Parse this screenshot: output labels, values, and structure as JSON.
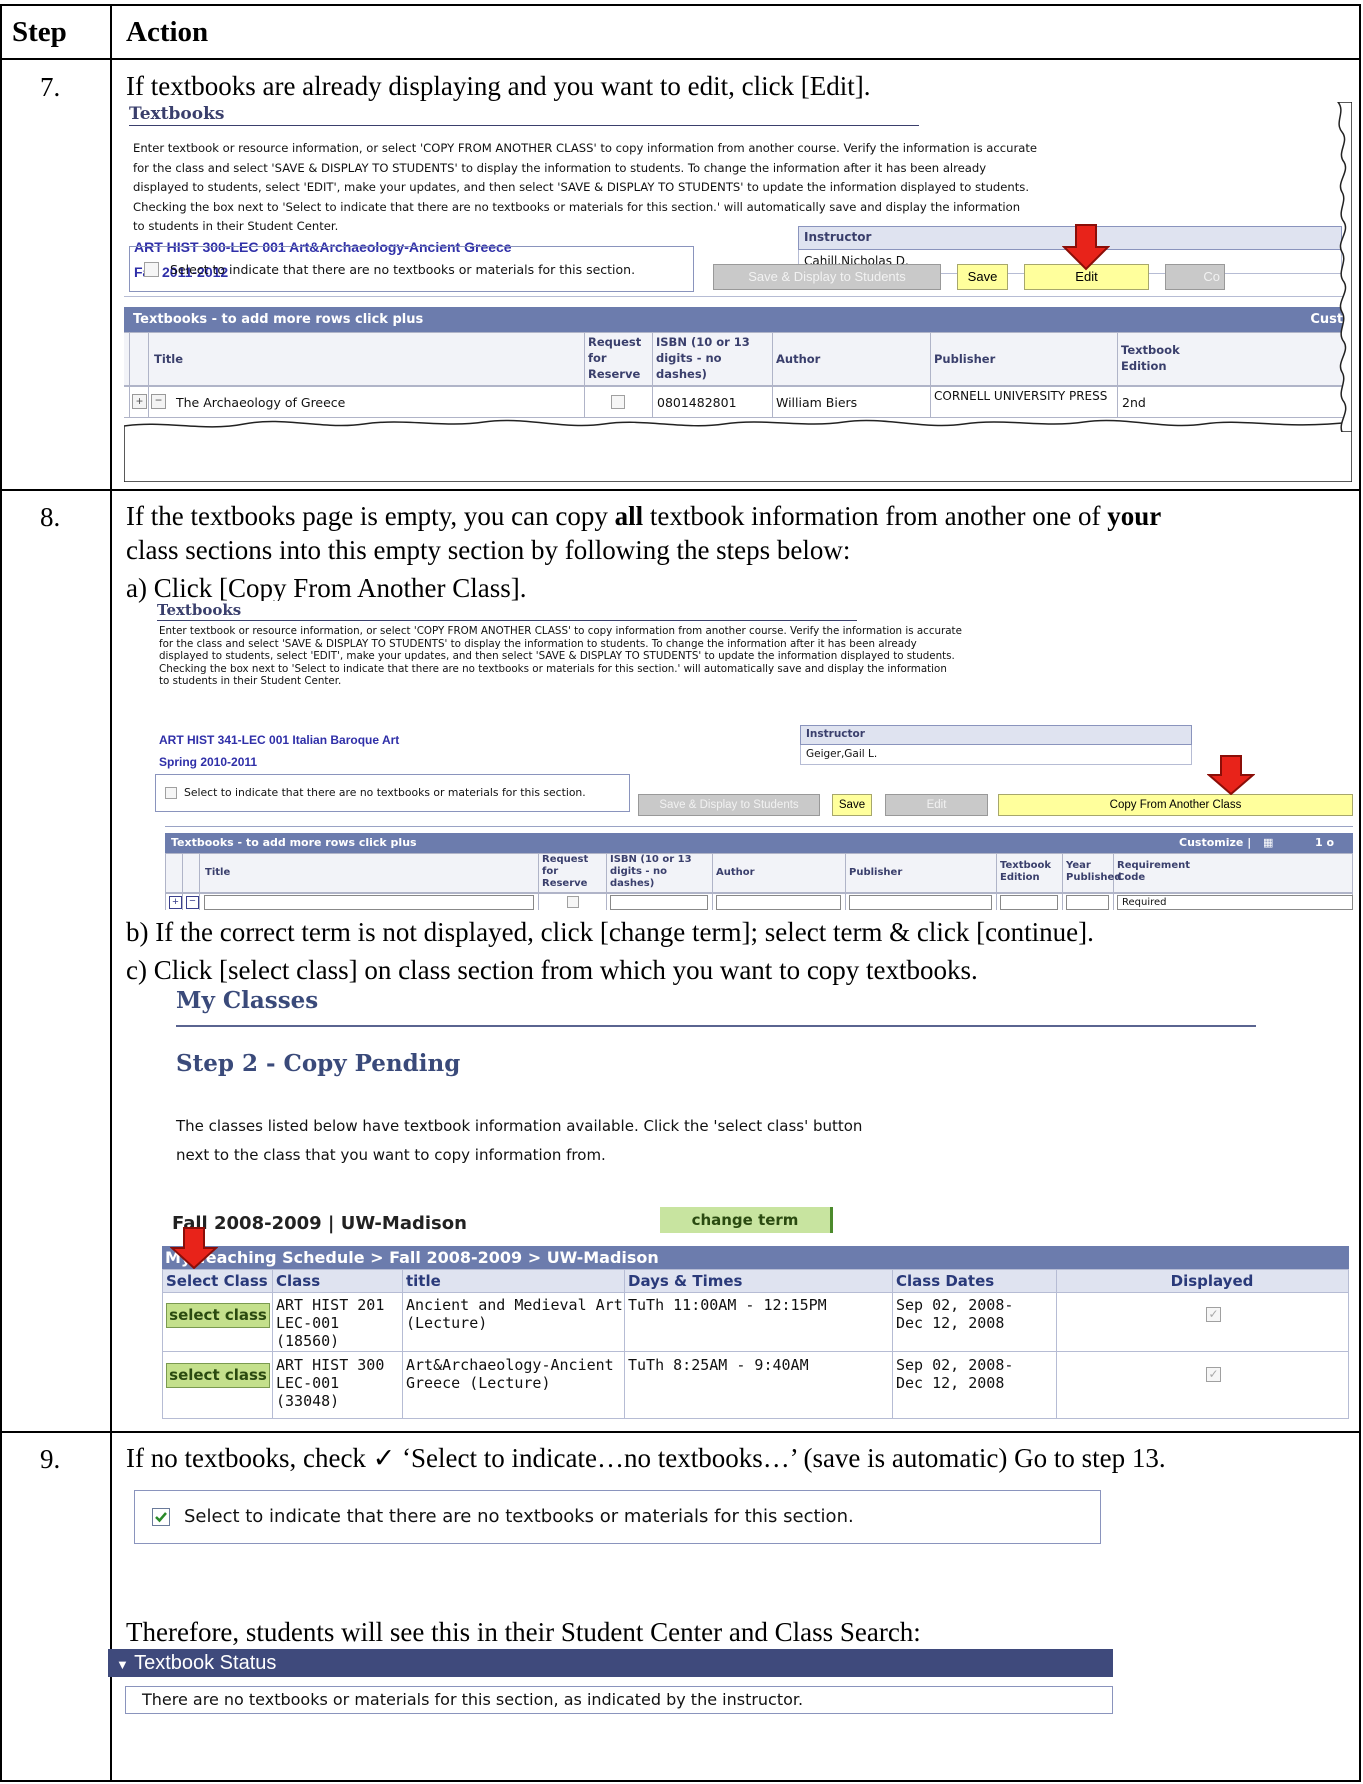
{
  "table": {
    "header_step": "Step",
    "header_action": "Action"
  },
  "step7": {
    "number": "7.",
    "text": "If textbooks are already displaying and you want to edit, click [Edit].",
    "shot": {
      "title": "Textbooks",
      "intro": [
        "Enter textbook or resource information, or select 'COPY FROM ANOTHER CLASS' to copy information from another course. Verify the information is accurate",
        "for the class and select 'SAVE & DISPLAY TO STUDENTS' to display the information to students. To change the information after it has been already",
        "displayed to students, select 'EDIT', make your updates, and then select 'SAVE & DISPLAY TO STUDENTS' to update the information displayed to students.",
        "Checking the box next to 'Select to indicate that there are no textbooks or materials for this section.' will automatically save and display the information",
        "to students in their Student Center."
      ],
      "course": "ART HIST  300-LEC 001   Art&Archaeology-Ancient Greece",
      "term": "Fall 2011-2012",
      "instructor_label": "Instructor",
      "instructor_name": "Cahill,Nicholas D.",
      "no_textbooks_label": "Select to indicate that there are no textbooks or materials for this section.",
      "btn_save_display": "Save & Display to Students",
      "btn_save": "Save",
      "btn_edit": "Edit",
      "btn_copy_partial": "Co",
      "grid_title": "Textbooks - to add more rows click plus",
      "grid_custom": "Custo",
      "col_title": "Title",
      "col_request": "Request for Reserve",
      "col_isbn": "ISBN (10 or 13 digits - no dashes)",
      "col_author": "Author",
      "col_publisher": "Publisher",
      "col_edition": "Textbook Edition",
      "row": {
        "title": "The Archaeology of Greece",
        "isbn": "0801482801",
        "author": "William Biers",
        "publisher": "CORNELL UNIVERSITY PRESS",
        "edition": "2nd"
      }
    }
  },
  "step8": {
    "number": "8.",
    "text_line1_a": "If the textbooks page is empty, you can copy ",
    "text_line1_b": "all",
    "text_line1_c": " textbook information from another one of ",
    "text_line1_d": "your",
    "text_line2": "class sections into this empty section by following the steps below:",
    "sub_a": "a)  Click [Copy From Another Class].",
    "sub_b": "b)  If the correct term is not displayed, click [change term]; select term & click [continue].",
    "sub_c": "c)   Click [select class] on class section from which you want to copy textbooks.",
    "shot_a": {
      "title": "Textbooks",
      "intro": [
        "Enter textbook or resource information, or select 'COPY FROM ANOTHER CLASS' to copy information from another course. Verify the information is accurate",
        "for the class and select 'SAVE & DISPLAY TO STUDENTS' to display the information to students. To change the information after it has been already",
        "displayed to students, select 'EDIT', make your updates, and then select 'SAVE & DISPLAY TO STUDENTS' to update the information displayed to students.",
        "Checking the box next to 'Select to indicate that there are no textbooks or materials for this section.' will automatically save and display the information",
        "to students in their Student Center."
      ],
      "course": "ART HIST  341-LEC 001   Italian Baroque Art",
      "term": "Spring 2010-2011",
      "instructor_label": "Instructor",
      "instructor_name": "Geiger,Gail L.",
      "no_textbooks_label": "Select to indicate that there are no textbooks or materials for this section.",
      "btn_save_display": "Save & Display to Students",
      "btn_save": "Save",
      "btn_edit": "Edit",
      "btn_copy": "Copy From Another Class",
      "grid_title": "Textbooks - to add more rows click plus",
      "grid_custom": "Customize |",
      "grid_pager": "1 o",
      "col_title": "Title",
      "col_request": "Request for Reserve",
      "col_isbn": "ISBN (10 or 13 digits - no dashes)",
      "col_author": "Author",
      "col_publisher": "Publisher",
      "col_edition": "Textbook Edition",
      "col_year": "Year Published",
      "col_req_code": "Requirement Code",
      "req_value": "Required"
    },
    "shot_c": {
      "title": "My Classes",
      "subtitle": "Step 2 - Copy Pending",
      "intro_line1": "The classes listed below have textbook information available. Click the 'select class' button",
      "intro_line2": "next to the class that you want to copy information from.",
      "term_heading": "Fall 2008-2009 | UW-Madison",
      "change_term": "change term",
      "breadcrumb": "My Teaching Schedule > Fall 2008-2009 > UW-Madison",
      "col_select": "Select Class",
      "col_class": "Class",
      "col_title": "title",
      "col_days": "Days & Times",
      "col_dates": "Class Dates",
      "col_displayed": "Displayed",
      "select_label": "select class",
      "rows": [
        {
          "class_l1": "ART HIST 201",
          "class_l2": "LEC-001",
          "class_l3": "(18560)",
          "title_l1": "Ancient and Medieval Art",
          "title_l2": "(Lecture)",
          "days": "TuTh 11:00AM - 12:15PM",
          "dates_l1": "Sep 02, 2008-",
          "dates_l2": "Dec 12, 2008"
        },
        {
          "class_l1": "ART HIST 300",
          "class_l2": "LEC-001",
          "class_l3": "(33048)",
          "title_l1": "Art&Archaeology-Ancient",
          "title_l2": "Greece (Lecture)",
          "days": "TuTh 8:25AM - 9:40AM",
          "dates_l1": "Sep 02, 2008-",
          "dates_l2": "Dec 12, 2008"
        }
      ]
    }
  },
  "step9": {
    "number": "9.",
    "text": "If no textbooks, check ✓ ‘Select to indicate…no textbooks…’ (save is automatic) Go to step 13.",
    "checkbox_label": "Select to indicate that there are no textbooks or materials for this section.",
    "therefore": "Therefore, students will see this in their Student Center and Class Search:",
    "status_header": "Textbook Status",
    "status_text": "There are no textbooks or materials for this section, as indicated by the instructor."
  },
  "colors": {
    "grid_header": "#6c7cad",
    "link": "#2f2fa8",
    "arrow": "#e8231a",
    "yellow_button": "#ffff9c",
    "select_button": "#c4e08c"
  }
}
